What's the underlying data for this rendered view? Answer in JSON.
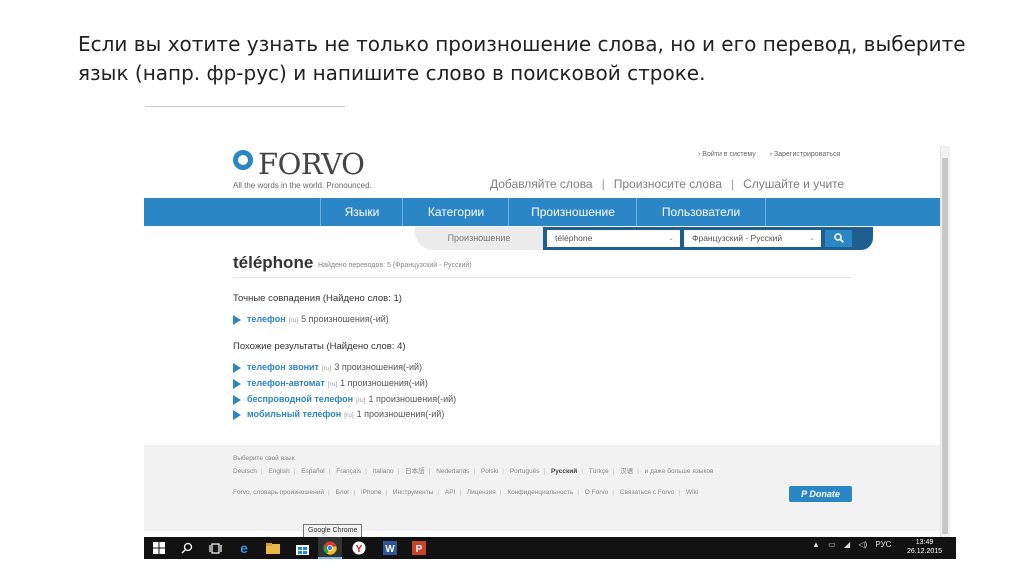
{
  "slide": {
    "title": "Если вы хотите узнать не только произношение слова, но и его перевод, выберите язык (напр. фр-рус) и напишите слово в поисковой строке."
  },
  "header": {
    "logo_text": "FORVO",
    "tagline": "All the words in the world. Pronounced.",
    "login": "› Войти в систему",
    "register": "› Зарегистрироваться",
    "secondary_nav": [
      "Добавляйте слова",
      "Произносите слова",
      "Слушайте и учите"
    ]
  },
  "nav": {
    "items": [
      "Языки",
      "Категории",
      "Произношение",
      "Пользователи"
    ]
  },
  "search": {
    "tab_label": "Произношение",
    "query": "téléphone",
    "language_pair": "Французский - Русский",
    "dropdown_arrow": "⌄",
    "button_icon": "search-icon"
  },
  "result": {
    "word": "téléphone",
    "subtitle": "Найдено переводов: 5 (Французский - Русский)",
    "exact_title": "Точные совпадения (Найдено слов: 1)",
    "exact": [
      {
        "word": "телефон",
        "lang": "[ru]",
        "count": "5 произношения(-ий)"
      }
    ],
    "similar_title": "Похожие результаты (Найдено слов: 4)",
    "similar": [
      {
        "word": "телефон звонит",
        "lang": "[ru]",
        "count": "3 произношения(-ий)"
      },
      {
        "word": "телефон-автомат",
        "lang": "[ru]",
        "count": "1 произношения(-ий)"
      },
      {
        "word": "беспроводной телефон",
        "lang": "[ru]",
        "count": "1 произношения(-ий)"
      },
      {
        "word": "мобильный телефон",
        "lang": "[ru]",
        "count": "1 произношения(-ий)"
      }
    ]
  },
  "footer": {
    "choose_lang": "Выберите свой язык",
    "languages": [
      "Deutsch",
      "English",
      "Español",
      "Français",
      "Italiano",
      "日本語",
      "Nederlands",
      "Polski",
      "Português",
      "Русский",
      "Türkçe",
      "汉语",
      "и даже больше языков"
    ],
    "current_language": "Русский",
    "links": [
      "Forvo, словарь произношений",
      "Блог",
      "iPhone",
      "Инструменты",
      "API",
      "Лицензия",
      "Конфиденциальность",
      "О Forvo",
      "Связаться с Forvo",
      "Wiki"
    ],
    "donate": "Donate"
  },
  "taskbar": {
    "tooltip": "Google Chrome",
    "apps": [
      "windows-icon",
      "search-icon",
      "task-view-icon",
      "edge-icon",
      "explorer-icon",
      "store-icon",
      "chrome-icon",
      "yandex-icon",
      "word-icon",
      "powerpoint-icon"
    ],
    "tray_lang": "РУС",
    "time": "13:49",
    "date": "26.12.2015"
  }
}
